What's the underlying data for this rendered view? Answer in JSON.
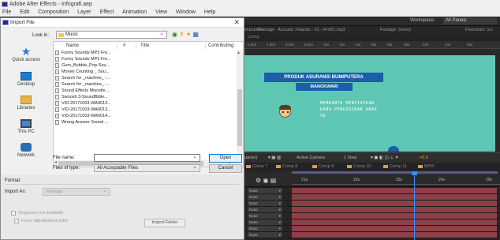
{
  "app": {
    "title": "Adobe After Effects - Infografi.aep",
    "menu": [
      "File",
      "Edit",
      "Composition",
      "Layer",
      "Effect",
      "Animation",
      "View",
      "Window",
      "Help"
    ],
    "workspace_label": "Workspace:",
    "workspace_value": "All Panels"
  },
  "panels": {
    "tabs": [
      "Composition",
      "Footage",
      "Acoustic Frilands - 01 - f4-d01.mp3",
      "Footage: (none)",
      "Flowchart: (co"
    ],
    "comp_label": "Comp",
    "ruler_ticks": [
      "2.00s",
      "4.00s",
      "6.00s",
      "8.00s",
      "10s",
      "12s",
      "14s",
      "16s",
      "18s",
      "20s",
      "22s",
      "24s",
      "26s"
    ]
  },
  "canvas": {
    "banner": "PRODUK ASURANSI BUMIPUTERA",
    "banner_sub": "MANOKWARI",
    "text_lines": [
      "MEMBANTU MENYIAPKAN",
      "DANA PENDIDIKAN ANAK",
      "SD"
    ],
    "colors": {
      "background": "#5ec7b4",
      "banner": "#1c5ea8"
    }
  },
  "viewer_controls": {
    "resolution": "(Quarter)",
    "camera": "Active Camera",
    "view": "1 View",
    "offset": "+0.0"
  },
  "comp_tabs": [
    "Comp 7",
    "Comp 8",
    "Comp 9",
    "Comp 10",
    "Comp 11",
    "BPM"
  ],
  "timeline": {
    "ticks": [
      "21s",
      "22s",
      "23s",
      "24s",
      "25s"
    ],
    "rows": [
      "None",
      "None",
      "None",
      "None",
      "None",
      "None",
      "None",
      "None"
    ]
  },
  "dialog": {
    "title": "Import File",
    "look_in_label": "Look in:",
    "look_in_value": "Music",
    "places": [
      "Quick access",
      "Desktop",
      "Libraries",
      "This PC",
      "Network"
    ],
    "columns": [
      "Name",
      "#",
      "Title",
      "Contributing"
    ],
    "files": [
      "Funny Sounds MP3 Fre...",
      "Funny Sounds MP3 Fre...",
      "Gum_Bubble_Pop-Sou...",
      "Money Counting _ Sou...",
      "Search for _machine_ -...",
      "Search for _machine_ -...",
      "Sound Effects Miscelle...",
      "Swoosh 3-SoundBible...",
      "VID-20171003-WA0013...",
      "VID-20171003-WA0013...",
      "VID-20171003-WA0014...",
      "Wrong Answer Sound ..."
    ],
    "file_name_label": "File name:",
    "file_name_value": "",
    "file_type_label": "Files of type:",
    "file_type_value": "All Acceptable Files",
    "open_label": "Open",
    "cancel_label": "Cancel",
    "format_label": "Format:",
    "import_as_label": "Import As:",
    "import_as_value": "Footage",
    "sequence_label": "Sequence not available",
    "force_alpha_label": "Force alphabetical order",
    "import_folder_label": "Import Folder"
  }
}
